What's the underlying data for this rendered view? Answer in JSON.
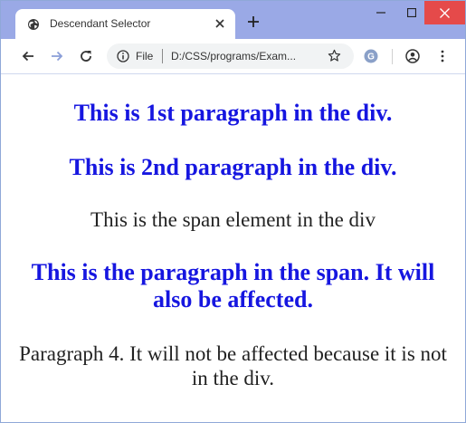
{
  "browser": {
    "tab": {
      "title": "Descendant Selector",
      "favicon": "globe-icon"
    },
    "address_bar": {
      "scheme_label": "File",
      "url": "D:/CSS/programs/Exam..."
    },
    "colors": {
      "title_bar": "#9aa9e6",
      "close_button": "#e54a4a"
    }
  },
  "page": {
    "paragraph_1": "This is 1st paragraph in the div.",
    "paragraph_2": "This is 2nd paragraph in the div.",
    "span_text": "This is the span element in the div",
    "paragraph_in_span": "This is the paragraph in the span. It will also be affected.",
    "paragraph_4": "Paragraph 4. It will not be affected because it is not in the div.",
    "colors": {
      "highlighted_text": "#1616e0",
      "plain_text": "#222222"
    }
  }
}
